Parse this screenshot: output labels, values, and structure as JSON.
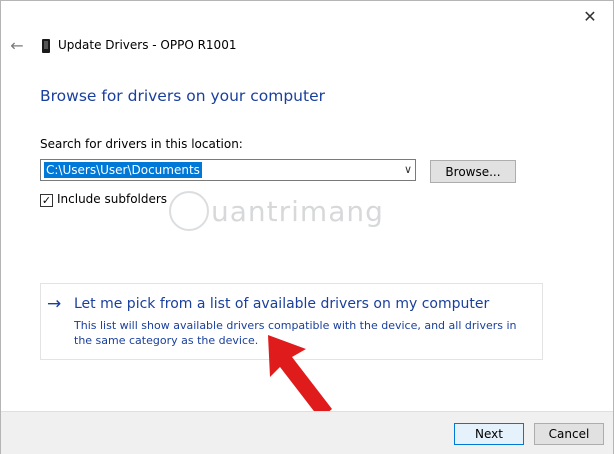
{
  "window": {
    "title": "Update Drivers - OPPO R1001",
    "close_glyph": "✕",
    "back_glyph": "←"
  },
  "main": {
    "heading": "Browse for drivers on your computer",
    "search_label": "Search for drivers in this location:",
    "path_value": "C:\\Users\\User\\Documents",
    "browse_label": "Browse...",
    "include_subfolders_label": "Include subfolders",
    "include_subfolders_checked": true,
    "watermark_text": "uantrimang"
  },
  "pick_option": {
    "title": "Let me pick from a list of available drivers on my computer",
    "description": "This list will show available drivers compatible with the device, and all drivers in the same category as the device."
  },
  "footer": {
    "next_label": "Next",
    "cancel_label": "Cancel"
  },
  "colors": {
    "accent_blue": "#1a3f9c",
    "selection_blue": "#0078d7",
    "annotation_red": "#e01b1b"
  },
  "icons": {
    "back": "back-arrow-icon",
    "device": "phone-device-icon",
    "close": "close-icon",
    "dropdown": "chevron-down-icon",
    "pick_arrow": "right-arrow-icon"
  }
}
